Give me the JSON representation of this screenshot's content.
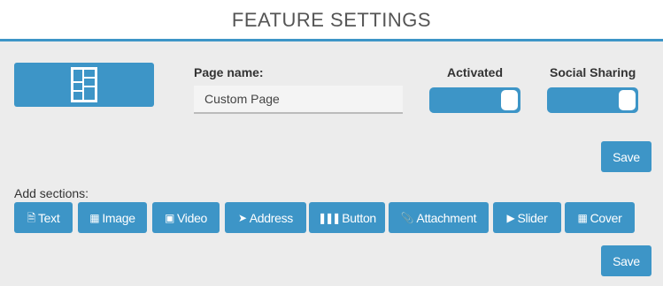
{
  "header": {
    "title": "FEATURE SETTINGS"
  },
  "form": {
    "page_name_label": "Page name:",
    "page_name_value": "Custom Page",
    "activated_label": "Activated",
    "activated_on": true,
    "social_label": "Social Sharing",
    "social_on": true,
    "save_label": "Save"
  },
  "sections": {
    "label": "Add sections:",
    "buttons": [
      {
        "label": "Text",
        "icon": "document-icon"
      },
      {
        "label": "Image",
        "icon": "image-icon"
      },
      {
        "label": "Video",
        "icon": "video-icon"
      },
      {
        "label": "Address",
        "icon": "location-arrow-icon"
      },
      {
        "label": "Button",
        "icon": "barcode-icon"
      },
      {
        "label": "Attachment",
        "icon": "paperclip-icon"
      },
      {
        "label": "Slider",
        "icon": "play-circle-icon"
      },
      {
        "label": "Cover",
        "icon": "image-file-icon"
      }
    ],
    "save_label": "Save"
  },
  "colors": {
    "accent": "#3d95c7",
    "background": "#ececec"
  }
}
